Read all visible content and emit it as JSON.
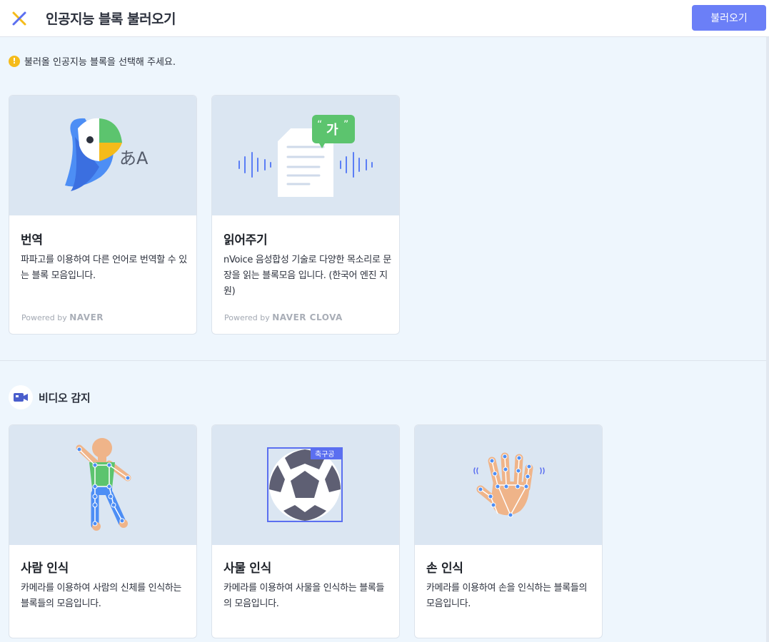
{
  "header": {
    "title": "인공지능 블록 불러오기",
    "load_label": "불러오기"
  },
  "notice": {
    "text": "불러올 인공지능 블록을 선택해 주세요.",
    "icon": "!"
  },
  "cards": [
    {
      "name": "번역",
      "desc": "파파고를 이용하여 다른 언어로 번역할 수 있는 블록 모음입니다.",
      "powered_prefix": "Powered by",
      "powered_brand": "NAVER",
      "image_text": "あA"
    },
    {
      "name": "읽어주기",
      "desc": "nVoice 음성합성 기술로 다양한 목소리로 문장을 읽는 블록모음 입니다. (한국어 엔진 지원)",
      "powered_prefix": "Powered by",
      "powered_brand": "NAVER CLOVA",
      "image_text": "가"
    }
  ],
  "video_section": {
    "title": "비디오 감지"
  },
  "video_cards": [
    {
      "name": "사람 인식",
      "desc": "카메라를 이용하여 사람의 신체를 인식하는 블록들의 모음입니다."
    },
    {
      "name": "사물 인식",
      "desc": "카메라를 이용하여 사물을 인식하는 블록들의 모음입니다.",
      "image_label": "축구공"
    },
    {
      "name": "손 인식",
      "desc": "카메라를 이용하여 손을 인식하는 블록들의 모음입니다."
    }
  ],
  "colors": {
    "accent": "#6b7ff7",
    "thumb_bg": "#dbe6f2",
    "page_bg": "#eef6fd",
    "notice": "#f5bb1a"
  }
}
